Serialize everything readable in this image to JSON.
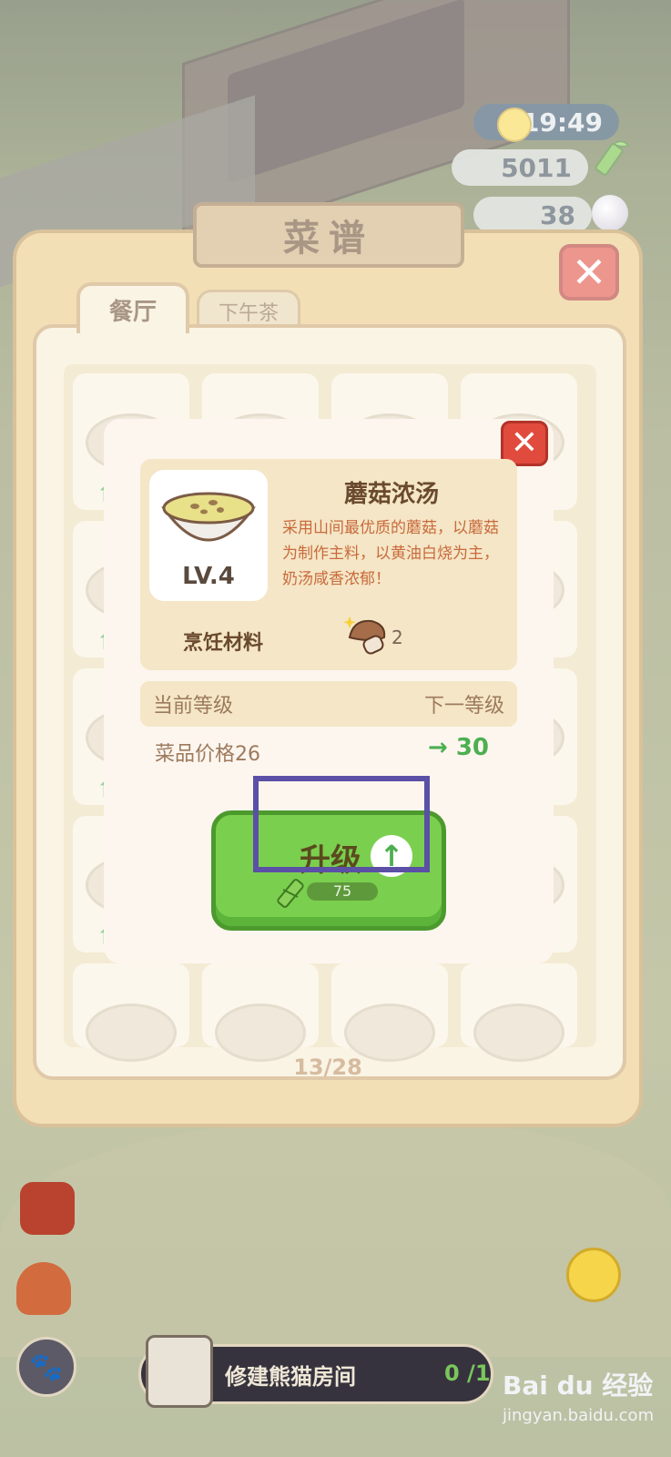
{
  "hud": {
    "time": "19:49",
    "bamboo_count": "5011",
    "pearl_count": "38"
  },
  "recipe_panel": {
    "title": "菜谱",
    "tabs": [
      {
        "label": "餐厅",
        "active": true
      },
      {
        "label": "下午茶",
        "active": false
      }
    ],
    "page_indicator": "13/28"
  },
  "dish_modal": {
    "level": "LV.4",
    "name": "蘑菇浓汤",
    "description": "采用山间最优质的蘑菇，以蘑菇为制作主料，以黄油白烧为主，奶汤咸香浓郁！",
    "materials_label": "烹饪材料",
    "material_count": "2",
    "current_level_label": "当前等级",
    "next_level_label": "下一等级",
    "price_label": "菜品价格26",
    "next_price": "30",
    "upgrade_label": "升级",
    "upgrade_cost": "75"
  },
  "quest": {
    "label": "修建熊猫房间",
    "progress": "0 /1"
  },
  "watermark": {
    "brand": "Bai du 经验",
    "url": "jingyan.baidu.com"
  },
  "colors": {
    "accent_green": "#4caf50",
    "close_red": "#e04b3d",
    "highlight_box": "#5b4fa6"
  }
}
